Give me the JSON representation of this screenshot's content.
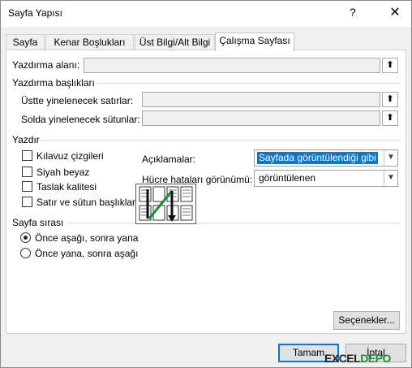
{
  "window": {
    "title": "Sayfa Yapısı",
    "help_glyph": "?",
    "close_glyph": "✕"
  },
  "tabs": [
    "Sayfa",
    "Kenar Boşlukları",
    "Üst Bilgi/Alt Bilgi",
    "Çalışma Sayfası"
  ],
  "active_tab": "Çalışma Sayfası",
  "print_area": {
    "label": "Yazdırma alanı:",
    "value": ""
  },
  "print_titles": {
    "group": "Yazdırma başlıkları",
    "rows_label": "Üstte yinelenecek satırlar:",
    "rows_value": "",
    "cols_label": "Solda yinelenecek sütunlar:",
    "cols_value": ""
  },
  "print": {
    "group": "Yazdır",
    "checkboxes": [
      {
        "label": "Kılavuz çizgileri",
        "checked": false
      },
      {
        "label": "Siyah beyaz",
        "checked": false
      },
      {
        "label": "Taslak kalitesi",
        "checked": false
      },
      {
        "label": "Satır ve sütun başlıkları",
        "checked": false
      }
    ],
    "comments_label": "Açıklamalar:",
    "comments_value": "Sayfada görüntülendiği gibi",
    "errors_label": "Hücre hataları görünümü:",
    "errors_value": "görüntülenen"
  },
  "page_order": {
    "group": "Sayfa sırası",
    "options": [
      {
        "label": "Önce aşağı, sonra yana",
        "selected": true
      },
      {
        "label": "Önce yana, sonra aşağı",
        "selected": false
      }
    ]
  },
  "buttons": {
    "options": "Seçenekler...",
    "ok": "Tamam",
    "cancel": "İptal"
  },
  "icons": {
    "collapse": "up-arrow-icon",
    "dropdown": "chevron-down-icon"
  },
  "watermark": {
    "part1": "EXCEL",
    "part2": "DEPO"
  }
}
